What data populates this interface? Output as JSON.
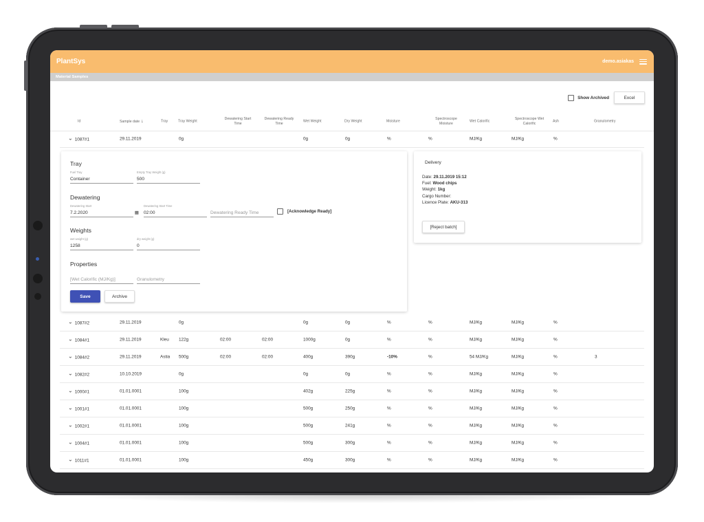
{
  "app": {
    "brand": "PlantSys",
    "user": "demo.asiakas",
    "page_title": "Material Samples"
  },
  "toolbar": {
    "show_archived_label": "Show Archived",
    "excel_label": "Excel"
  },
  "columns": {
    "id": "Id",
    "sample_date": "Sample date",
    "tray": "Tray",
    "tray_weight": "Tray Weight",
    "dewatering_start_1": "Dewatering Start",
    "dewatering_start_2": "Time",
    "dewatering_ready_1": "Dewatering Ready",
    "dewatering_ready_2": "Time",
    "wet_weight": "Wet Weight",
    "dry_weight": "Dry Weight",
    "moisture": "Moisture",
    "spectro_moisture_1": "Spectroscope",
    "spectro_moisture_2": "Moisture",
    "wet_calorific": "Wet Calorific",
    "spectro_wet_1": "Spectroscope Wet",
    "spectro_wet_2": "Calorific",
    "ash": "Ash",
    "granulometry": "Granulometry"
  },
  "rows": [
    {
      "id": "1087#1",
      "date": "29.11.2019",
      "tray": "",
      "tray_weight": "0g",
      "dw_start": "",
      "dw_ready": "",
      "wet": "0g",
      "dry": "0g",
      "moisture": "%",
      "spectro_moisture": "%",
      "wet_cal": "MJ/Kg",
      "spectro_wet": "MJ/Kg",
      "ash": "%",
      "gran": ""
    },
    {
      "id": "1087#2",
      "date": "29.11.2019",
      "tray": "",
      "tray_weight": "0g",
      "dw_start": "",
      "dw_ready": "",
      "wet": "0g",
      "dry": "0g",
      "moisture": "%",
      "spectro_moisture": "%",
      "wet_cal": "MJ/Kg",
      "spectro_wet": "MJ/Kg",
      "ash": "%",
      "gran": ""
    },
    {
      "id": "1084#1",
      "date": "29.11.2019",
      "tray": "Kleu",
      "tray_weight": "122g",
      "dw_start": "02:00",
      "dw_ready": "02:00",
      "wet": "1000g",
      "dry": "0g",
      "moisture": "%",
      "spectro_moisture": "%",
      "wet_cal": "MJ/Kg",
      "spectro_wet": "MJ/Kg",
      "ash": "%",
      "gran": ""
    },
    {
      "id": "1084#2",
      "date": "29.11.2019",
      "tray": "Astia",
      "tray_weight": "500g",
      "dw_start": "02:00",
      "dw_ready": "02:00",
      "wet": "400g",
      "dry": "390g",
      "moisture": "-10%",
      "spectro_moisture": "%",
      "wet_cal": "54 MJ/Kg",
      "spectro_wet": "MJ/Kg",
      "ash": "%",
      "gran": "3"
    },
    {
      "id": "1082#2",
      "date": "10.10.2019",
      "tray": "",
      "tray_weight": "0g",
      "dw_start": "",
      "dw_ready": "",
      "wet": "0g",
      "dry": "0g",
      "moisture": "%",
      "spectro_moisture": "%",
      "wet_cal": "MJ/Kg",
      "spectro_wet": "MJ/Kg",
      "ash": "%",
      "gran": ""
    },
    {
      "id": "1000#1",
      "date": "01.01.0001",
      "tray": "",
      "tray_weight": "100g",
      "dw_start": "",
      "dw_ready": "",
      "wet": "402g",
      "dry": "225g",
      "moisture": "%",
      "spectro_moisture": "%",
      "wet_cal": "MJ/Kg",
      "spectro_wet": "MJ/Kg",
      "ash": "%",
      "gran": ""
    },
    {
      "id": "1001#1",
      "date": "01.01.0001",
      "tray": "",
      "tray_weight": "100g",
      "dw_start": "",
      "dw_ready": "",
      "wet": "500g",
      "dry": "250g",
      "moisture": "%",
      "spectro_moisture": "%",
      "wet_cal": "MJ/Kg",
      "spectro_wet": "MJ/Kg",
      "ash": "%",
      "gran": ""
    },
    {
      "id": "1002#1",
      "date": "01.01.0001",
      "tray": "",
      "tray_weight": "100g",
      "dw_start": "",
      "dw_ready": "",
      "wet": "500g",
      "dry": "241g",
      "moisture": "%",
      "spectro_moisture": "%",
      "wet_cal": "MJ/Kg",
      "spectro_wet": "MJ/Kg",
      "ash": "%",
      "gran": ""
    },
    {
      "id": "1004#1",
      "date": "01.01.0001",
      "tray": "",
      "tray_weight": "100g",
      "dw_start": "",
      "dw_ready": "",
      "wet": "500g",
      "dry": "300g",
      "moisture": "%",
      "spectro_moisture": "%",
      "wet_cal": "MJ/Kg",
      "spectro_wet": "MJ/Kg",
      "ash": "%",
      "gran": ""
    },
    {
      "id": "1011#1",
      "date": "01.01.0001",
      "tray": "",
      "tray_weight": "100g",
      "dw_start": "",
      "dw_ready": "",
      "wet": "450g",
      "dry": "300g",
      "moisture": "%",
      "spectro_moisture": "%",
      "wet_cal": "MJ/Kg",
      "spectro_wet": "MJ/Kg",
      "ash": "%",
      "gran": ""
    }
  ],
  "detail": {
    "tray": {
      "title": "Tray",
      "fuel_tray_label": "Fuel Tray",
      "fuel_tray_value": "Container",
      "empty_weight_label": "Empty Tray Weight (g)",
      "empty_weight_value": "500"
    },
    "dewatering": {
      "title": "Dewatering",
      "start_label": "Dewatering Start",
      "start_value": "7.2.2020",
      "start_time_label": "Dewatering Start Time",
      "start_time_value": "02:00",
      "ready_time_placeholder": "Dewatering Ready Time",
      "ack_label": "[Acknowledge Ready]"
    },
    "weights": {
      "title": "Weights",
      "wet_label": "wet weight (g)",
      "wet_value": "1258",
      "dry_label": "dry weight (g)",
      "dry_value": "0"
    },
    "properties": {
      "title": "Properties",
      "wet_cal_placeholder": "[Wet Calorific (MJ/Kg)]",
      "gran_placeholder": "Granulometry"
    },
    "save_label": "Save",
    "archive_label": "Archive"
  },
  "delivery": {
    "title": "Delivery",
    "date_label": "Date: ",
    "date_value": "29.11.2019 15:12",
    "fuel_label": "Fuel: ",
    "fuel_value": "Wood chips",
    "weight_label": "Weight: ",
    "weight_value": "1kg",
    "cargo_label": "Cargo Number:",
    "plate_label": "Licence Plate: ",
    "plate_value": "AKU-313",
    "reject_label": "[Reject batch]"
  },
  "icons": {
    "chevron": "chevron-down-icon",
    "sort": "arrow-down-icon",
    "menu": "hamburger-menu-icon",
    "calendar": "calendar-icon"
  },
  "colors": {
    "appbar": "#f9bc6e",
    "primary": "#3f51b5"
  }
}
